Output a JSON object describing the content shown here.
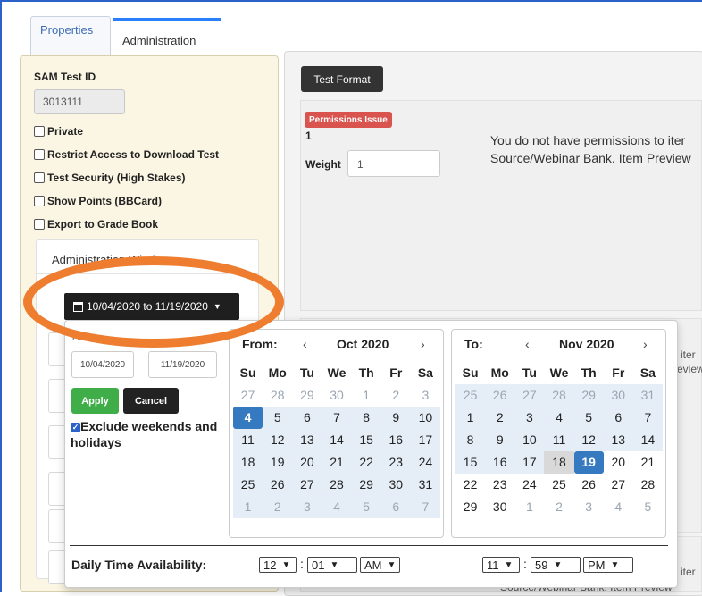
{
  "tabs": [
    {
      "label": "Properties"
    },
    {
      "label": "Administration"
    }
  ],
  "left": {
    "sam_label": "SAM Test ID",
    "sam_value": "3013111",
    "checkboxes": [
      {
        "label": "Private",
        "checked": false
      },
      {
        "label": "Restrict Access to Download Test",
        "checked": false
      },
      {
        "label": "Test Security (High Stakes)",
        "checked": false
      },
      {
        "label": "Show Points (BBCard)",
        "checked": false
      },
      {
        "label": "Export to Grade Book",
        "checked": false
      }
    ],
    "admin_window_title": "Administration Window"
  },
  "right": {
    "test_format_label": "Test Format",
    "permissions_badge": "Permissions Issue",
    "item_number": "1",
    "weight_label": "Weight",
    "weight_value": "1",
    "permission_message_line1": "You do not have permissions to iter",
    "permission_message_line2": "Source/Webinar Bank. Item Preview",
    "fragments": [
      "iter",
      "eview",
      "iter",
      "Source/Webinar Bank. Item Preview"
    ]
  },
  "date_range": {
    "button_label": "10/04/2020 to 11/19/2020"
  },
  "picker": {
    "from_label": "FROM",
    "from_value": "10/04/2020",
    "to_value": "11/19/2020",
    "apply_label": "Apply",
    "cancel_label": "Cancel",
    "exclude_label": "Exclude weekends and holidays",
    "exclude_checked": true,
    "left_calendar": {
      "label": "From:",
      "month": "Oct 2020",
      "prev": "‹",
      "next": "›"
    },
    "right_calendar": {
      "label": "To:",
      "month": "Nov 2020",
      "prev": "‹",
      "next": "›"
    },
    "weekdays": [
      "Su",
      "Mo",
      "Tu",
      "We",
      "Th",
      "Fr",
      "Sa"
    ],
    "oct_days": [
      [
        27,
        28,
        29,
        30,
        1,
        2,
        3
      ],
      [
        4,
        5,
        6,
        7,
        8,
        9,
        10
      ],
      [
        11,
        12,
        13,
        14,
        15,
        16,
        17
      ],
      [
        18,
        19,
        20,
        21,
        22,
        23,
        24
      ],
      [
        25,
        26,
        27,
        28,
        29,
        30,
        31
      ],
      [
        1,
        2,
        3,
        4,
        5,
        6,
        7
      ]
    ],
    "nov_days": [
      [
        25,
        26,
        27,
        28,
        29,
        30,
        31
      ],
      [
        1,
        2,
        3,
        4,
        5,
        6,
        7
      ],
      [
        8,
        9,
        10,
        11,
        12,
        13,
        14
      ],
      [
        15,
        16,
        17,
        18,
        19,
        20,
        21
      ],
      [
        22,
        23,
        24,
        25,
        26,
        27,
        28
      ],
      [
        29,
        30,
        1,
        2,
        3,
        4,
        5
      ]
    ],
    "daily_label": "Daily Time Availability:",
    "start_hour": "12",
    "start_minute": "01",
    "start_ampm": "AM",
    "end_hour": "11",
    "end_minute": "59",
    "end_ampm": "PM",
    "time_separator": ":"
  },
  "colors": {
    "highlight": "#ee7d2f",
    "active_day": "#3579c0",
    "in_range": "#e5eef7",
    "apply": "#3fae49",
    "badge": "#d9534f"
  }
}
